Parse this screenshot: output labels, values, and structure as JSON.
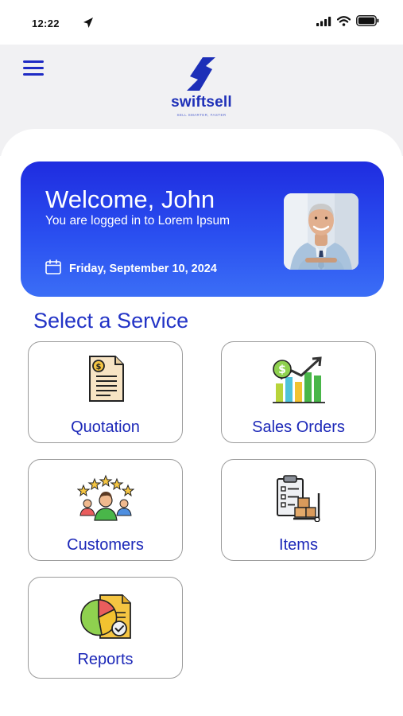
{
  "status_bar": {
    "time": "12:22",
    "icons": [
      "location-arrow-icon",
      "signal-icon",
      "wifi-icon",
      "battery-icon"
    ]
  },
  "header": {
    "menu_icon": "hamburger-menu-icon",
    "brand_name": "swiftsell",
    "brand_tagline": "SELL SMARTER, FASTER"
  },
  "welcome": {
    "title": "Welcome, John",
    "subtitle": "You are logged in to Lorem Ipsum",
    "date": "Friday, September 10, 2024",
    "date_icon": "calendar-icon",
    "avatar": "user-avatar-photo"
  },
  "section_title": "Select a Service",
  "services": [
    {
      "label": "Quotation",
      "icon": "quotation-document-icon"
    },
    {
      "label": "Sales Orders",
      "icon": "sales-chart-icon"
    },
    {
      "label": "Customers",
      "icon": "customers-rating-icon"
    },
    {
      "label": "Items",
      "icon": "items-clipboard-icon"
    },
    {
      "label": "Reports",
      "icon": "reports-pie-chart-icon"
    }
  ],
  "colors": {
    "primary": "#1f2bc4",
    "card_gradient_top": "#1f2ce0",
    "card_gradient_bottom": "#3b6ef6",
    "header_bg": "#f1f1f3"
  }
}
